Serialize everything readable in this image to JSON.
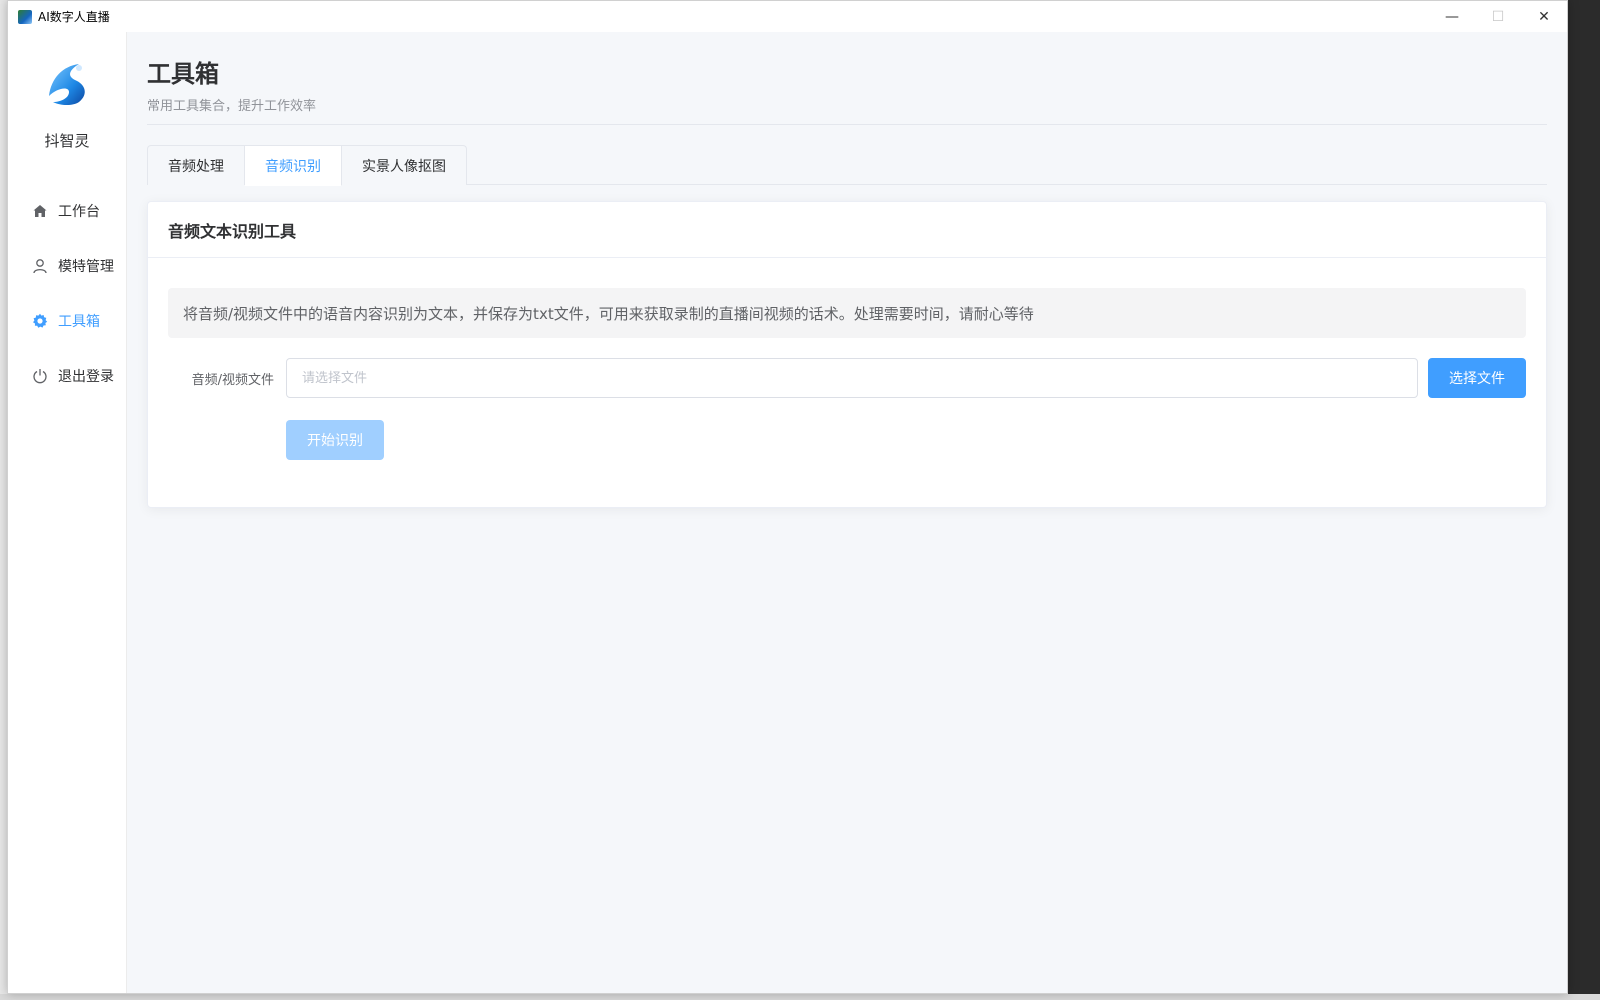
{
  "window": {
    "title": "AI数字人直播",
    "controls": {
      "minimize": "—",
      "maximize": "☐",
      "close": "✕"
    }
  },
  "sidebar": {
    "brand": "抖智灵",
    "items": [
      {
        "label": "工作台",
        "icon": "home-icon",
        "active": false
      },
      {
        "label": "模特管理",
        "icon": "user-icon",
        "active": false
      },
      {
        "label": "工具箱",
        "icon": "gear-icon",
        "active": true
      },
      {
        "label": "退出登录",
        "icon": "power-icon",
        "active": false
      }
    ]
  },
  "header": {
    "title": "工具箱",
    "subtitle": "常用工具集合，提升工作效率"
  },
  "tabs": [
    {
      "label": "音频处理",
      "active": false
    },
    {
      "label": "音频识别",
      "active": true
    },
    {
      "label": "实景人像抠图",
      "active": false
    }
  ],
  "card": {
    "title": "音频文本识别工具",
    "info": "将音频/视频文件中的语音内容识别为文本，并保存为txt文件，可用来获取录制的直播间视频的话术。处理需要时间，请耐心等待",
    "file_label": "音频/视频文件",
    "file_value": "",
    "file_placeholder": "请选择文件",
    "choose_button": "选择文件",
    "start_button": "开始识别"
  },
  "colors": {
    "accent": "#409eff",
    "accent_disabled": "#a0cfff",
    "background": "#f5f7fa"
  }
}
